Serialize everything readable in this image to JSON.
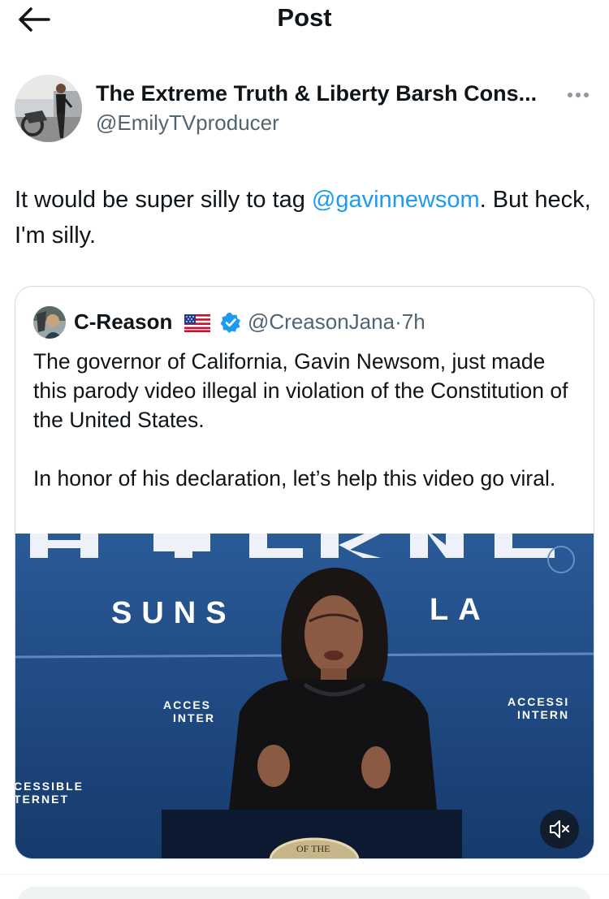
{
  "header": {
    "title": "Post",
    "back_icon": "arrow-left-icon"
  },
  "post": {
    "author": {
      "display_name": "The Extreme Truth & Liberty Barsh Cons...",
      "handle": "@EmilyTVproducer"
    },
    "more_icon": "more-horizontal-icon",
    "text_before": "It would be super silly to tag ",
    "mention": "@gavinnewsom",
    "text_after": ". But heck, I'm silly."
  },
  "quote": {
    "author": {
      "display_name": "C-Reason",
      "flag_icon": "us-flag-icon",
      "verified_icon": "verified-badge-icon",
      "handle": "@CreasonJana",
      "separator": "·",
      "time": "7h"
    },
    "text": "The governor of California, Gavin Newsom, just made this parody video illegal in violation of the Constitution of the United States.\n\nIn honor of his declaration, let’s help this video go viral.",
    "media": {
      "sign_text_1": "SUNS",
      "sign_text_2": "LA",
      "sign_left_1": "CESSIBLE",
      "sign_left_2": "TERNET",
      "sign_mid_1": "ACCES",
      "sign_mid_2": "INTER",
      "sign_right_1": "ACCESSI",
      "sign_right_2": "INTERN",
      "podium_seal_text": "OF THE",
      "mute_icon": "speaker-muted-icon"
    }
  },
  "colors": {
    "accent": "#1d9bf0",
    "secondary_text": "#536471",
    "border": "#cfd9de",
    "video_bg": "#1f4b86"
  }
}
